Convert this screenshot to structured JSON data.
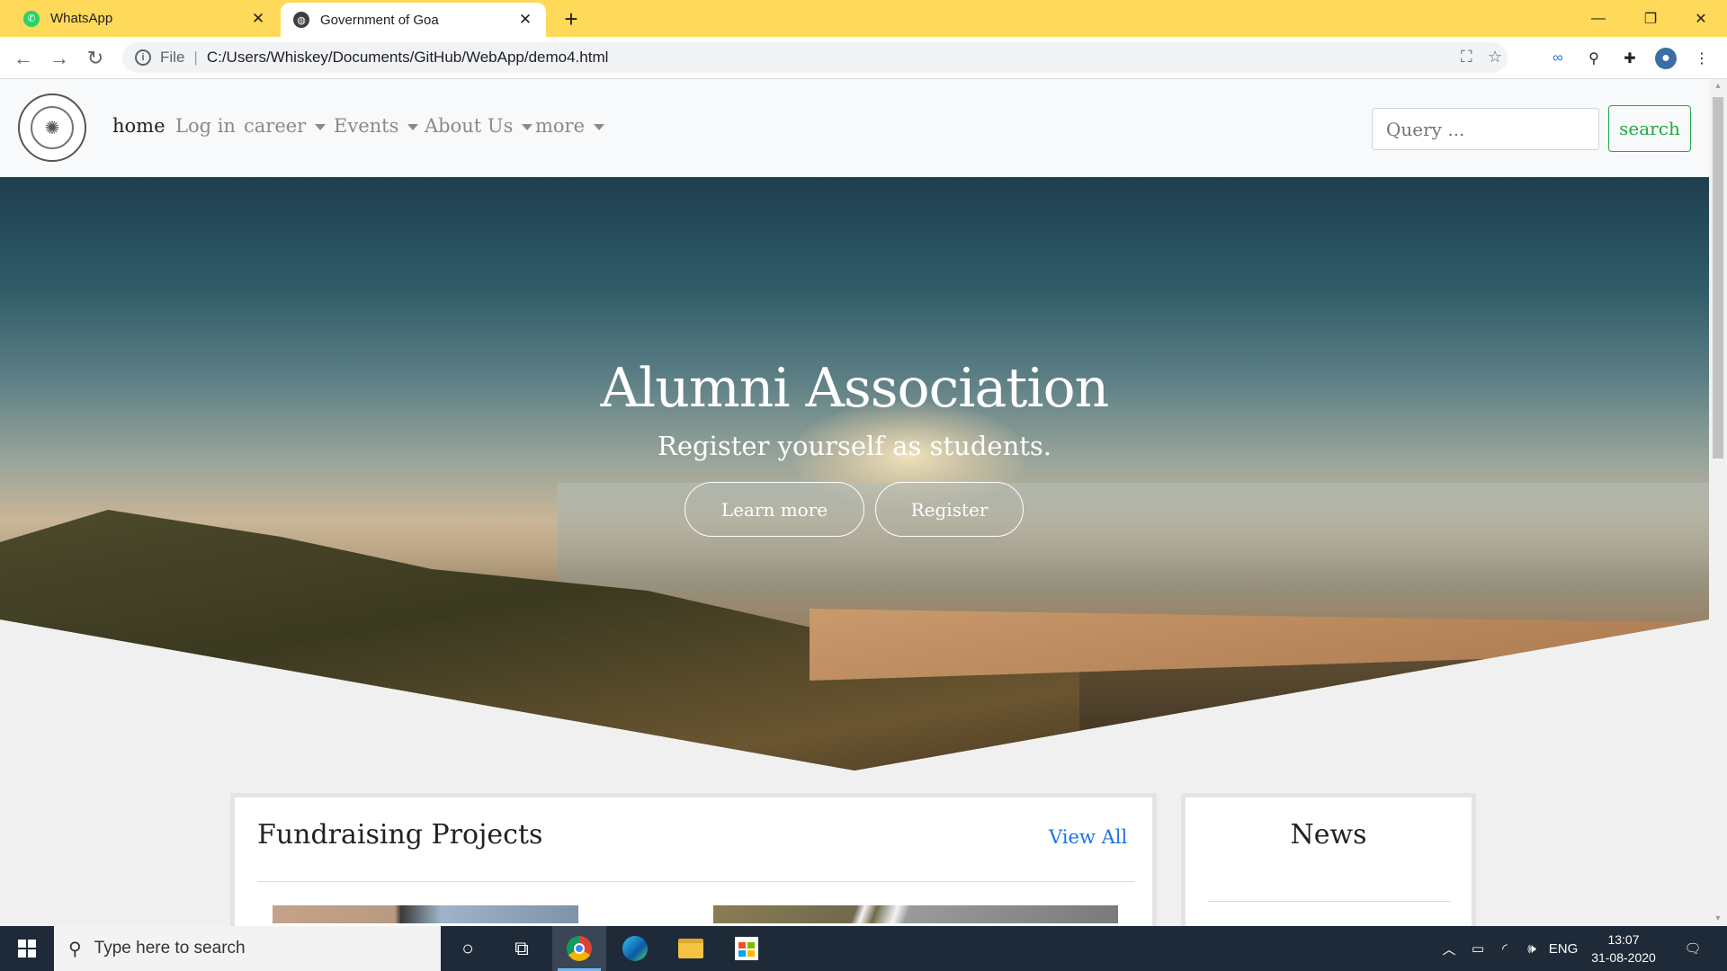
{
  "browser": {
    "tabs": [
      {
        "title": "WhatsApp",
        "icon": "whatsapp-icon",
        "active": false
      },
      {
        "title": "Government of Goa",
        "icon": "globe-icon",
        "active": true
      }
    ],
    "new_tab_icon": "+",
    "url_scheme": "File",
    "url": "C:/Users/Whiskey/Documents/GitHub/WebApp/demo4.html",
    "accent_color": "#ffd95a"
  },
  "site": {
    "nav": {
      "items": [
        {
          "label": "home",
          "active": true,
          "dropdown": false
        },
        {
          "label": "Log in",
          "active": false,
          "dropdown": false
        },
        {
          "label": "career",
          "active": false,
          "dropdown": true
        },
        {
          "label": "Events",
          "active": false,
          "dropdown": true
        },
        {
          "label": "About Us",
          "active": false,
          "dropdown": true
        },
        {
          "label": "more",
          "active": false,
          "dropdown": true
        }
      ],
      "search_placeholder": "Query ...",
      "search_button": "search",
      "search_button_color": "#28a745"
    },
    "hero": {
      "title": "Alumni Association",
      "subtitle": "Register yourself as students.",
      "buttons": [
        "Learn more",
        "Register"
      ]
    },
    "cards": {
      "fundraising": {
        "title": "Fundraising Projects",
        "link": "View All"
      },
      "news": {
        "title": "News"
      }
    }
  },
  "taskbar": {
    "search_placeholder": "Type here to search",
    "language": "ENG",
    "time": "13:07",
    "date": "31-08-2020"
  }
}
